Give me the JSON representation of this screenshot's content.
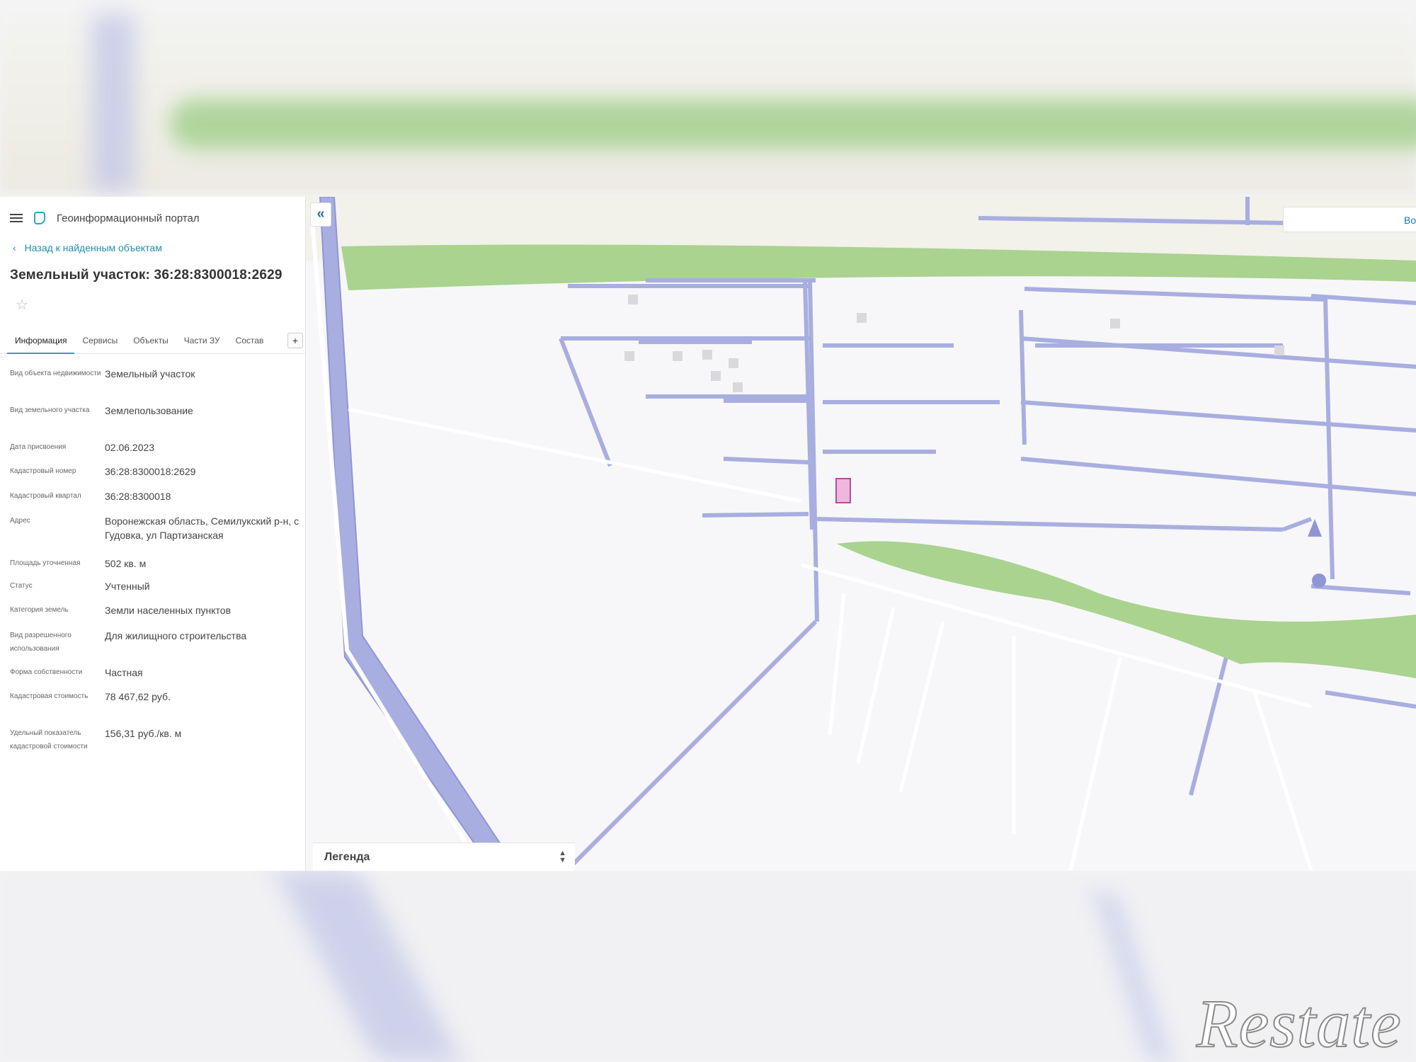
{
  "header": {
    "portal_title": "Геоинформационный портал",
    "back_link": "Назад к найденным объектам",
    "object_title": "Земельный участок: 36:28:8300018:2629"
  },
  "tabs": [
    {
      "label": "Информация",
      "active": true
    },
    {
      "label": "Сервисы"
    },
    {
      "label": "Объекты"
    },
    {
      "label": "Части ЗУ"
    },
    {
      "label": "Состав"
    }
  ],
  "tabs_more": "+",
  "properties": [
    {
      "label": "Вид объекта недвижимости",
      "value": "Земельный участок"
    },
    {
      "label": "Вид земельного участка",
      "value": "Землепользование"
    },
    {
      "label": "Дата присвоения",
      "value": "02.06.2023"
    },
    {
      "label": "Кадастровый номер",
      "value": "36:28:8300018:2629"
    },
    {
      "label": "Кадастровый квартал",
      "value": "36:28:8300018"
    },
    {
      "label": "Адрес",
      "value": "Воронежская область, Семилукский р-н, с Гудовка, ул Партизанская"
    },
    {
      "label": "Площадь уточненная",
      "value": "502 кв. м"
    },
    {
      "label": "Статус",
      "value": "Учтенный"
    },
    {
      "label": "Категория земель",
      "value": "Земли населенных пунктов"
    },
    {
      "label": "Вид разрешенного использования",
      "value": "Для жилищного строительства"
    },
    {
      "label": "Форма собственности",
      "value": "Частная"
    },
    {
      "label": "Кадастровая стоимость",
      "value": "78 467,62 руб."
    },
    {
      "label": "Удельный показатель кадастровой стоимости",
      "value": "156,31 руб./кв. м"
    }
  ],
  "map": {
    "collapse_label": "«",
    "search_partial": "Во",
    "legend_label": "Легенда",
    "legend_arrows": "▲▼",
    "colors": {
      "road_blue": "#a8aee0",
      "green": "#a9d38f",
      "parcel_fill": "#f0b6de",
      "parcel_stroke": "#b0509a",
      "accent": "#2aa6b6"
    }
  },
  "watermark": "Restate",
  "icons": [
    "menu-icon",
    "portal-logo-icon",
    "chevron-left-icon",
    "star-icon",
    "plus-icon",
    "collapse-icon",
    "sort-arrows-icon",
    "location-pin-icon"
  ]
}
